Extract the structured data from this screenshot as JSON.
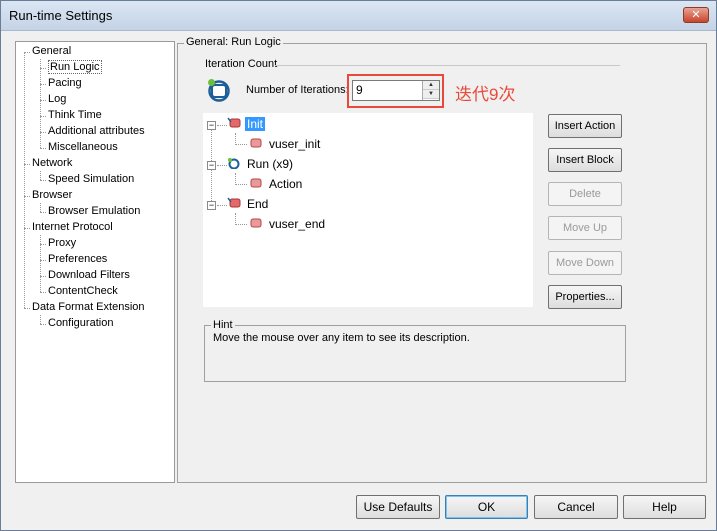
{
  "window": {
    "title": "Run-time Settings",
    "close_glyph": "✕"
  },
  "nav_tree": [
    {
      "label": "General",
      "level": 0
    },
    {
      "label": "Run Logic",
      "level": 1,
      "selected": true
    },
    {
      "label": "Pacing",
      "level": 1
    },
    {
      "label": "Log",
      "level": 1
    },
    {
      "label": "Think Time",
      "level": 1
    },
    {
      "label": "Additional attributes",
      "level": 1
    },
    {
      "label": "Miscellaneous",
      "level": 1
    },
    {
      "label": "Network",
      "level": 0
    },
    {
      "label": "Speed Simulation",
      "level": 1
    },
    {
      "label": "Browser",
      "level": 0
    },
    {
      "label": "Browser Emulation",
      "level": 1
    },
    {
      "label": "Internet Protocol",
      "level": 0
    },
    {
      "label": "Proxy",
      "level": 1
    },
    {
      "label": "Preferences",
      "level": 1
    },
    {
      "label": "Download Filters",
      "level": 1
    },
    {
      "label": "ContentCheck",
      "level": 1
    },
    {
      "label": "Data Format Extension",
      "level": 0
    },
    {
      "label": "Configuration",
      "level": 1
    }
  ],
  "main": {
    "section_title": "General: Run Logic",
    "iteration_group": "Iteration Count",
    "iterations_label": "Number of Iterations:",
    "iterations_value": "9",
    "annotation": "迭代9次"
  },
  "logic_tree": {
    "init": "Init",
    "vuser_init": "vuser_init",
    "run": "Run (x9)",
    "action": "Action",
    "end": "End",
    "vuser_end": "vuser_end"
  },
  "side_buttons": {
    "insert_action": "Insert Action",
    "insert_block": "Insert Block",
    "delete": "Delete",
    "move_up": "Move Up",
    "move_down": "Move Down",
    "properties": "Properties..."
  },
  "hint": {
    "title": "Hint",
    "text": "Move the mouse over any item to see its description."
  },
  "bottom_buttons": {
    "use_defaults": "Use Defaults",
    "ok": "OK",
    "cancel": "Cancel",
    "help": "Help"
  },
  "colors": {
    "annotation": "#e84a3a",
    "selection": "#3399ff"
  }
}
